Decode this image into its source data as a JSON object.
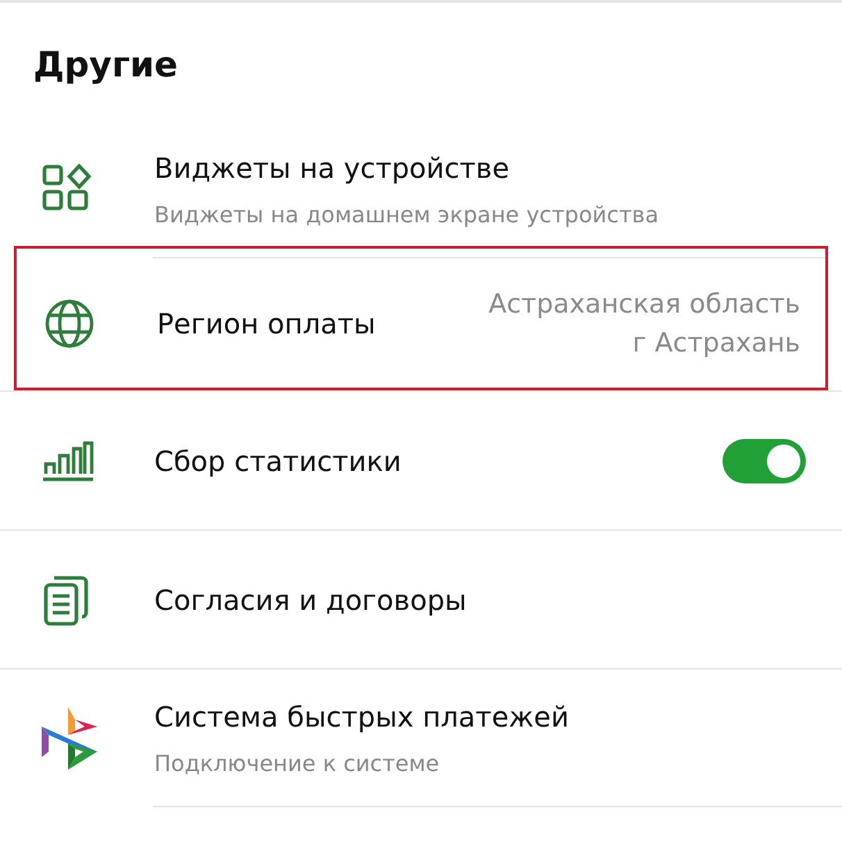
{
  "section": {
    "title": "Другие"
  },
  "items": [
    {
      "kind": "subtitle",
      "title": "Виджеты на устройстве",
      "subtitle": "Виджеты на домашнем экране устройства",
      "highlighted": false
    },
    {
      "kind": "value",
      "title": "Регион оплаты",
      "value_lines": [
        "Астраханская область",
        "г Астрахань"
      ],
      "highlighted": true
    },
    {
      "kind": "toggle",
      "title": "Сбор статистики",
      "on": true,
      "highlighted": false
    },
    {
      "kind": "plain",
      "title": "Согласия и договоры",
      "highlighted": false
    },
    {
      "kind": "subtitle",
      "title": "Система быстрых платежей",
      "subtitle": "Подключение к системе",
      "highlighted": false
    }
  ]
}
